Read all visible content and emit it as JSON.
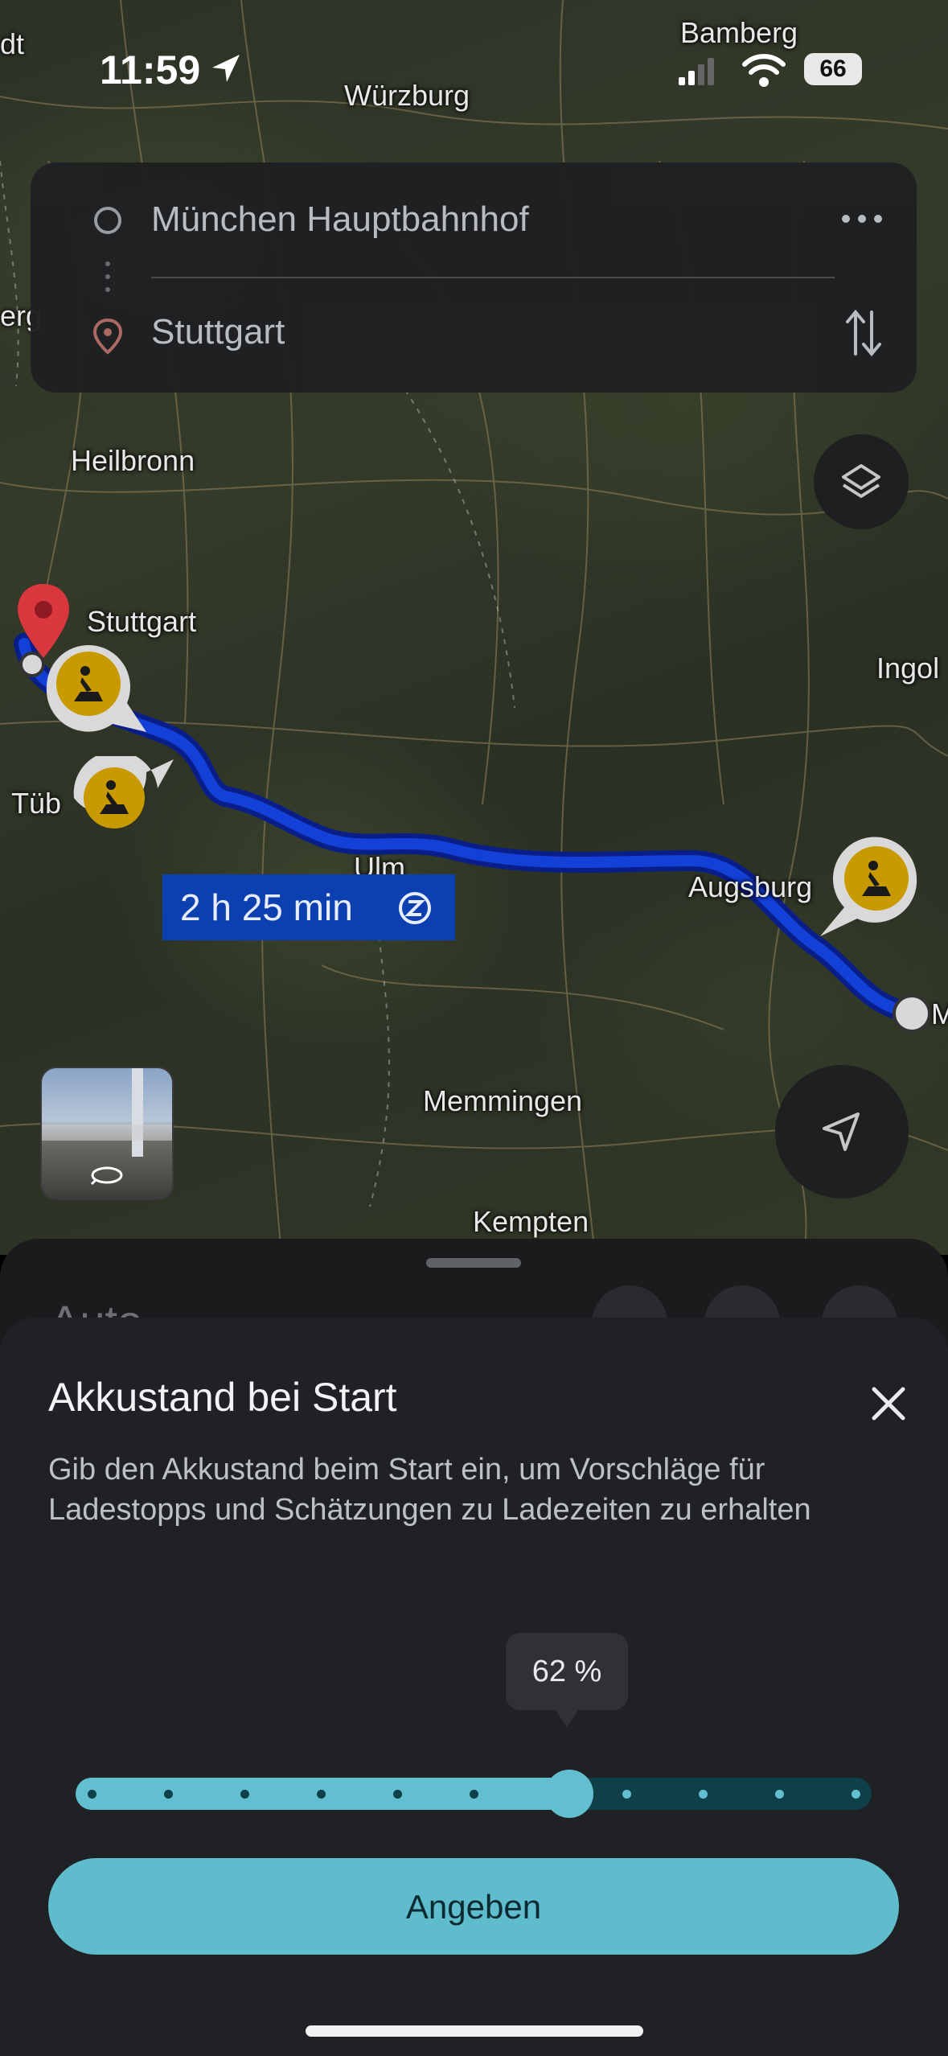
{
  "status_bar": {
    "time": "11:59",
    "battery": "66"
  },
  "search": {
    "origin": "München Hauptbahnhof",
    "destination": "Stuttgart"
  },
  "map": {
    "cities": [
      "Bamberg",
      "Würzburg",
      "Heilbronn",
      "Stuttgart",
      "Ingol",
      "Tüb",
      "Ulm",
      "Augsburg",
      "Memmingen",
      "Kempten",
      "dt",
      "erg",
      "M"
    ],
    "route_duration": "2 h 25 min",
    "route_color": "#0d2fb8"
  },
  "back_sheet": {
    "title": "Auto"
  },
  "dialog": {
    "title": "Akkustand bei Start",
    "description": "Gib den Akkustand beim Start ein, um Vorschläge für Ladestopps und Schätzungen zu Ladezeiten zu erhalten",
    "slider_tooltip": "62 %",
    "slider_value_percent": 62,
    "button_label": "Angeben",
    "accent_color": "#5fbccd"
  },
  "icons": [
    "location-arrow-icon",
    "signal-icon",
    "wifi-icon",
    "battery-icon",
    "origin-circle-icon",
    "destination-pin-icon",
    "more-icon",
    "swap-icon",
    "layers-icon",
    "navigate-icon",
    "construction-icon",
    "close-icon",
    "rotate-360-icon"
  ]
}
